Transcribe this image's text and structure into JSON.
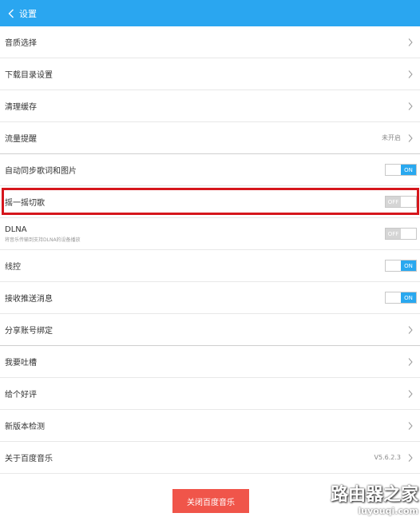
{
  "header": {
    "title": "设置"
  },
  "items": [
    {
      "label": "音质选择"
    },
    {
      "label": "下载目录设置"
    },
    {
      "label": "清理缓存"
    },
    {
      "label": "流量提醒",
      "value": "未开启"
    },
    {
      "label": "自动同步歌词和图片",
      "toggle": "ON"
    },
    {
      "label": "摇一摇切歌",
      "toggle": "OFF"
    },
    {
      "label": "DLNA",
      "sub": "将音乐传输到支持DLNA的设备播放",
      "toggle": "OFF"
    },
    {
      "label": "线控",
      "toggle": "ON"
    },
    {
      "label": "接收推送消息",
      "toggle": "ON"
    },
    {
      "label": "分享账号绑定"
    },
    {
      "label": "我要吐槽"
    },
    {
      "label": "给个好评"
    },
    {
      "label": "新版本检测"
    },
    {
      "label": "关于百度音乐",
      "value": "V5.6.2.3"
    }
  ],
  "close_button": "关闭百度音乐",
  "watermark": {
    "main": "路由器之家",
    "sub": "luyouqi.com"
  },
  "colors": {
    "header": "#2aa6f0",
    "toggle_on": "#29a8ef",
    "highlight": "#d6161c",
    "close_button": "#f0554a"
  }
}
